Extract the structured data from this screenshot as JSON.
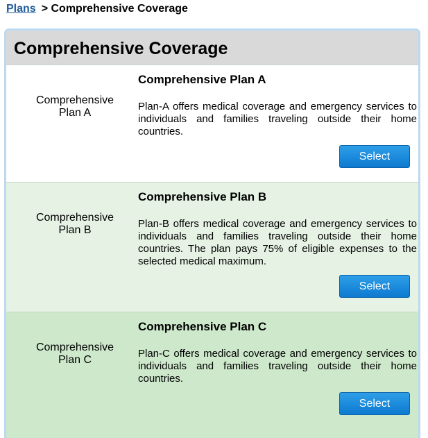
{
  "breadcrumb": {
    "link": "Plans",
    "separator": ">",
    "current": "Comprehensive Coverage"
  },
  "panel": {
    "title": "Comprehensive Coverage"
  },
  "plans": [
    {
      "side_line1": "Comprehensive",
      "side_line2": "Plan A",
      "title": "Comprehensive Plan A",
      "description": "Plan-A offers medical coverage and emergency services to individuals and families traveling outside their home countries.",
      "button": "Select"
    },
    {
      "side_line1": "Comprehensive",
      "side_line2": "Plan B",
      "title": "Comprehensive Plan B",
      "description": "Plan-B offers medical coverage and emergency services to individuals and families traveling outside their home countries. The plan pays 75% of eligible expenses to the selected medical maximum.",
      "button": "Select"
    },
    {
      "side_line1": "Comprehensive",
      "side_line2": "Plan C",
      "title": "Comprehensive Plan C",
      "description": "Plan-C offers medical coverage and emergency services to individuals and families traveling outside their home countries.",
      "button": "Select"
    }
  ],
  "colors": {
    "link": "#1f5a99",
    "header_bg": "#d9d9d9",
    "panel_border": "#bcd9ef",
    "plan_a_bg": "#ffffff",
    "plan_b_bg": "#e6f3e4",
    "plan_c_bg": "#cde8cb",
    "button_bg": "#1a8ade"
  }
}
